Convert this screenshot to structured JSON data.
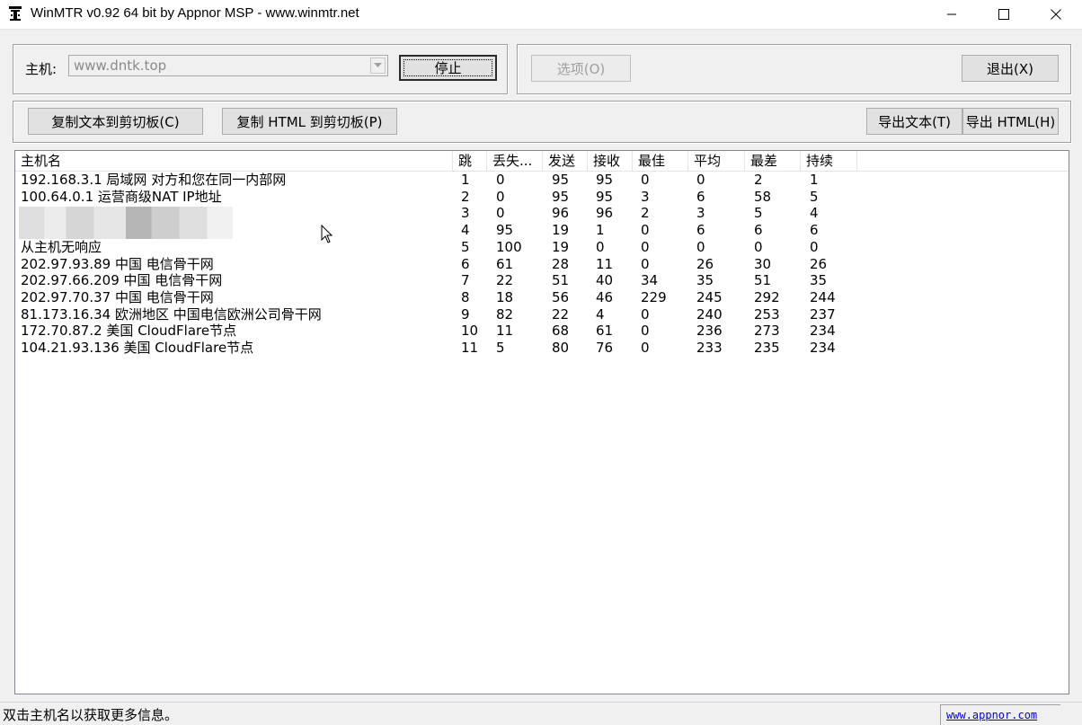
{
  "window": {
    "title": "WinMTR v0.92 64 bit by Appnor MSP - www.winmtr.net"
  },
  "host_group": {
    "host_label": "主机:",
    "host_value": "www.dntk.top",
    "stop_label": "停止"
  },
  "options_group": {
    "options_label": "选项(O)",
    "exit_label": "退出(X)"
  },
  "export_group": {
    "copy_text_label": "复制文本到剪切板(C)",
    "copy_html_label": "复制 HTML 到剪切板(P)",
    "export_text_label": "导出文本(T)",
    "export_html_label": "导出 HTML(H)"
  },
  "table": {
    "columns": [
      "主机名",
      "跳",
      "丢失...",
      "发送",
      "接收",
      "最佳",
      "平均",
      "最差",
      "持续"
    ],
    "rows": [
      [
        "192.168.3.1 局域网 对方和您在同一内部网",
        "1",
        "0",
        "95",
        "95",
        "0",
        "0",
        "2",
        "1"
      ],
      [
        "100.64.0.1 运营商级NAT IP地址",
        "2",
        "0",
        "95",
        "95",
        "3",
        "6",
        "58",
        "5"
      ],
      [
        "",
        "3",
        "0",
        "96",
        "96",
        "2",
        "3",
        "5",
        "4"
      ],
      [
        "",
        "4",
        "95",
        "19",
        "1",
        "0",
        "6",
        "6",
        "6"
      ],
      [
        "从主机无响应",
        "5",
        "100",
        "19",
        "0",
        "0",
        "0",
        "0",
        "0"
      ],
      [
        "202.97.93.89 中国 电信骨干网",
        "6",
        "61",
        "28",
        "11",
        "0",
        "26",
        "30",
        "26"
      ],
      [
        "202.97.66.209 中国 电信骨干网",
        "7",
        "22",
        "51",
        "40",
        "34",
        "35",
        "51",
        "35"
      ],
      [
        "202.97.70.37 中国 电信骨干网",
        "8",
        "18",
        "56",
        "46",
        "229",
        "245",
        "292",
        "244"
      ],
      [
        "81.173.16.34 欧洲地区 中国电信欧洲公司骨干网",
        "9",
        "82",
        "22",
        "4",
        "0",
        "240",
        "253",
        "237"
      ],
      [
        "172.70.87.2 美国 CloudFlare节点",
        "10",
        "11",
        "68",
        "61",
        "0",
        "236",
        "273",
        "234"
      ],
      [
        "104.21.93.136 美国 CloudFlare节点",
        "11",
        "5",
        "80",
        "76",
        "0",
        "233",
        "235",
        "234"
      ]
    ]
  },
  "statusbar": {
    "message": "双击主机名以获取更多信息。",
    "link": "www.appnor.com"
  },
  "colors": {
    "link": "#0000ee",
    "disabled_text": "#a0a0a0"
  }
}
